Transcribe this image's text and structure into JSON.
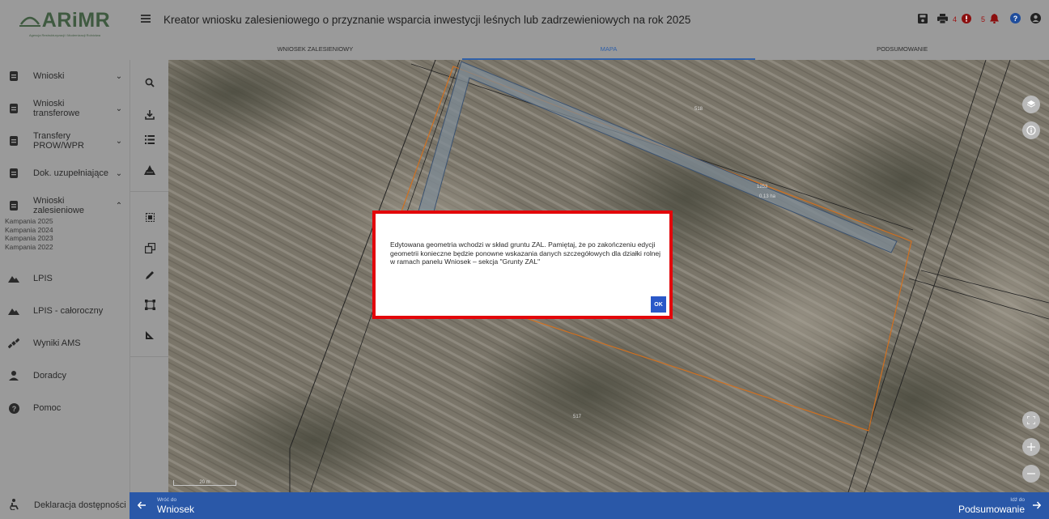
{
  "header": {
    "title": "Kreator wniosku zalesieniowego o przyznanie wsparcia inwestycji leśnych lub zadrzewieniowych na rok 2025",
    "print_count": "4",
    "alerts_count": "5"
  },
  "logo": {
    "text": "ARiMR",
    "subtitle": "Agencja Restrukturyzacji i Modernizacji Rolnictwa"
  },
  "tabs": [
    {
      "label": "WNIOSEK ZALESIENIOWY"
    },
    {
      "label": "MAPA"
    },
    {
      "label": "PODSUMOWANIE"
    }
  ],
  "sidebar": {
    "items": [
      {
        "label": "Wnioski",
        "icon": "document-icon"
      },
      {
        "label": "Wnioski transferowe",
        "icon": "document-icon"
      },
      {
        "label": "Transfery PROW/WPR",
        "icon": "document-icon"
      },
      {
        "label": "Dok. uzupełniające",
        "icon": "document-icon"
      },
      {
        "label": "Wnioski zalesieniowe",
        "icon": "document-icon"
      },
      {
        "label": "LPIS",
        "icon": "terrain-icon"
      },
      {
        "label": "LPIS - całoroczny",
        "icon": "terrain-icon"
      },
      {
        "label": "Wyniki AMS",
        "icon": "satellite-icon"
      },
      {
        "label": "Doradcy",
        "icon": "person-icon"
      },
      {
        "label": "Pomoc",
        "icon": "help-icon"
      }
    ],
    "campaigns": [
      "Kampania 2025",
      "Kampania 2024",
      "Kampania 2023",
      "Kampania 2022"
    ],
    "accessibility": "Deklaracja dostępności"
  },
  "map": {
    "labels": {
      "parcel_top": "518",
      "parcel_strip": "1253",
      "parcel_strip_area": "0.13 ha",
      "parcel_bottom": "517"
    },
    "scale": "20 m"
  },
  "dialog": {
    "message": "Edytowana geometria wchodzi w skład gruntu ZAL. Pamiętaj, że po zakończeniu edycji geometrii konieczne będzie ponowne wskazania danych szczegółowych dla działki rolnej w ramach panelu Wniosek – sekcja \"Grunty ZAL\"",
    "ok_label": "OK"
  },
  "bottom": {
    "back_small": "Wróć do",
    "back_label": "Wniosek",
    "next_small": "Idź do",
    "next_label": "Podsumowanie"
  },
  "colors": {
    "accent": "#2a58a8",
    "highlight_frame": "#e3050a",
    "parcel_outline": "#d07020"
  }
}
